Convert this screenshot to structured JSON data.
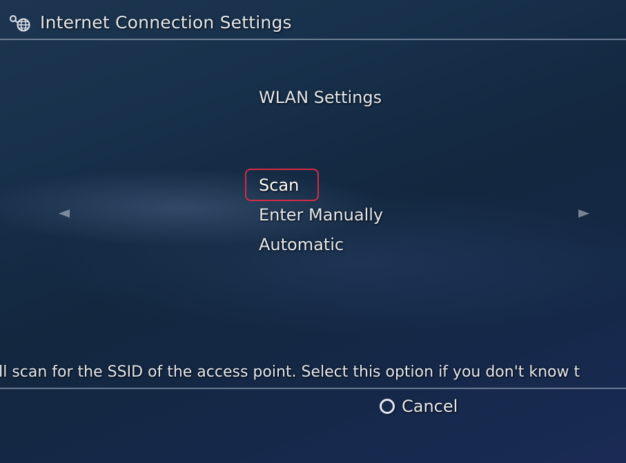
{
  "header": {
    "title": "Internet Connection Settings",
    "icon": "network-settings-icon"
  },
  "section": {
    "title": "WLAN Settings"
  },
  "menu": {
    "items": [
      {
        "label": "Scan",
        "selected": true
      },
      {
        "label": "Enter Manually",
        "selected": false
      },
      {
        "label": "Automatic",
        "selected": false
      }
    ]
  },
  "navigation": {
    "left_icon": "left-arrow-icon",
    "right_icon": "right-arrow-icon"
  },
  "help": {
    "text": "ill scan for the SSID of the access point. Select this option if you don't know t"
  },
  "footer": {
    "cancel_label": "Cancel",
    "cancel_icon": "circle-button-icon"
  },
  "colors": {
    "highlight": "#d62c44",
    "text": "#e4e8ee",
    "background": "#17304b"
  }
}
